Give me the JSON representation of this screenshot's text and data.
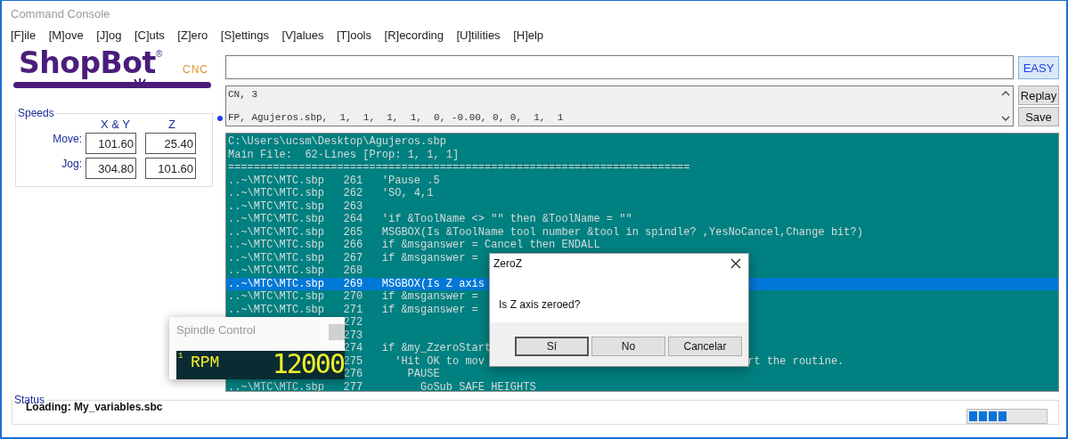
{
  "window": {
    "title": "Command Console"
  },
  "menu": [
    "[F]ile",
    "[M]ove",
    "[J]og",
    "[C]uts",
    "[Z]ero",
    "[S]ettings",
    "[V]alues",
    "[T]ools",
    "[R]ecording",
    "[U]tilities",
    "[H]elp"
  ],
  "logo": {
    "name": "ShopBot",
    "mark": "®",
    "suffix": "CNC"
  },
  "speeds": {
    "title": "Speeds",
    "columns": [
      "X & Y",
      "Z"
    ],
    "rows": [
      {
        "label": "Move:",
        "values": [
          "101.60",
          "25.40"
        ]
      },
      {
        "label": "Jog:",
        "values": [
          "304.80",
          "101.60"
        ]
      }
    ]
  },
  "easy_button": "EASY",
  "history": [
    {
      "text": "CN, 3",
      "current": false
    },
    {
      "text": "FP, Agujeros.sbp,  1,  1,  1,  1,  0, -0.00, 0, 0,  1,  1",
      "current": true
    }
  ],
  "history_buttons": [
    "Replay",
    "Save"
  ],
  "console": {
    "header": [
      "C:\\Users\\ucsm\\Desktop\\Agujeros.sbp",
      "Main File:  62-Lines [Prop: 1, 1, 1]",
      "========================================================================"
    ],
    "rows": [
      {
        "file": "..~\\MTC\\MTC.sbp",
        "line": "261",
        "code": "'Pause .5",
        "selected": false
      },
      {
        "file": "..~\\MTC\\MTC.sbp",
        "line": "262",
        "code": "'SO, 4,1",
        "selected": false
      },
      {
        "file": "..~\\MTC\\MTC.sbp",
        "line": "263",
        "selected": false
      },
      {
        "file": "..~\\MTC\\MTC.sbp",
        "line": "264",
        "code": "'if &ToolName <> \"\" then &ToolName = \"\"",
        "selected": false
      },
      {
        "file": "..~\\MTC\\MTC.sbp",
        "line": "265",
        "code": "MSGBOX(Is &ToolName tool number &tool in spindle? ,YesNoCancel,Change bit?)",
        "selected": false
      },
      {
        "file": "..~\\MTC\\MTC.sbp",
        "line": "266",
        "code": "if &msganswer = Cancel then ENDALL",
        "selected": false
      },
      {
        "file": "..~\\MTC\\MTC.sbp",
        "line": "267",
        "code": "if &msganswer =",
        "selected": false
      },
      {
        "file": "..~\\MTC\\MTC.sbp",
        "line": "268",
        "selected": false
      },
      {
        "file": "..~\\MTC\\MTC.sbp",
        "line": "269",
        "code": "MSGBOX(Is Z axis",
        "selected": true
      },
      {
        "file": "..~\\MTC\\MTC.sbp",
        "line": "270",
        "code": "if &msganswer =",
        "selected": false
      },
      {
        "file": "..~\\MTC\\MTC.sbp",
        "line": "271",
        "code": "if &msganswer =",
        "selected": false
      },
      {
        "line": "272",
        "selected": false
      },
      {
        "line": "273",
        "selected": false
      },
      {
        "line": "274",
        "code": "if &my_ZzeroStart",
        "selected": false
      },
      {
        "line": "275",
        "code": "  'Hit OK to mov",
        "tail": "rt the routine.",
        "selected": false
      },
      {
        "line": "276",
        "code": "    PAUSE",
        "selected": false
      },
      {
        "file": "..~\\MTC\\MTC.sbp",
        "line": "277",
        "code": "      GoSub SAFE_HEIGHTS",
        "selected": false
      }
    ]
  },
  "spindle": {
    "title": "Spindle Control",
    "index": "1",
    "unit": "RPM",
    "value": "12000"
  },
  "dialog": {
    "title": "ZeroZ",
    "message": "Is Z axis zeroed?",
    "buttons": [
      "Sí",
      "No",
      "Cancelar"
    ]
  },
  "status": {
    "title": "Status",
    "text": "Loading: My_variables.sbc",
    "level": 0.5
  }
}
